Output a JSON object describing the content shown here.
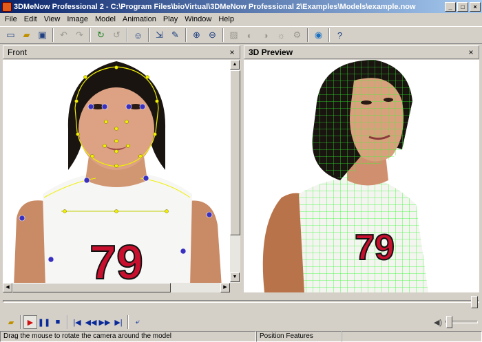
{
  "window": {
    "title": "3DMeNow Professional 2 - C:\\Program Files\\bioVirtual\\3DMeNow Professional 2\\Examples\\Models\\example.now"
  },
  "menu": [
    "File",
    "Edit",
    "View",
    "Image",
    "Model",
    "Animation",
    "Play",
    "Window",
    "Help"
  ],
  "toolbar_icons": [
    "new-file-icon",
    "open-folder-icon",
    "save-icon",
    "undo-icon",
    "redo-icon",
    "rotate-left-icon",
    "rotate-right-icon",
    "person-scan-icon",
    "import-icon",
    "tools-icon",
    "zoom-in-icon",
    "zoom-out-icon",
    "image-icon",
    "contrast-icon",
    "half-tone-icon",
    "brightness-icon",
    "settings-icon",
    "globe-icon",
    "help-icon"
  ],
  "panels": {
    "front": {
      "title": "Front",
      "close": "×"
    },
    "preview": {
      "title": "3D Preview",
      "close": "×"
    }
  },
  "shirt_number": "79",
  "status": {
    "hint": "Drag the mouse to rotate the camera around the model",
    "mode": "Position Features",
    "extra": ""
  },
  "colors": {
    "mesh": "#2dff2d",
    "feature_point": "#f0f000",
    "feature_marker": "#3a30c0",
    "shirt_number": "#c8102e"
  }
}
